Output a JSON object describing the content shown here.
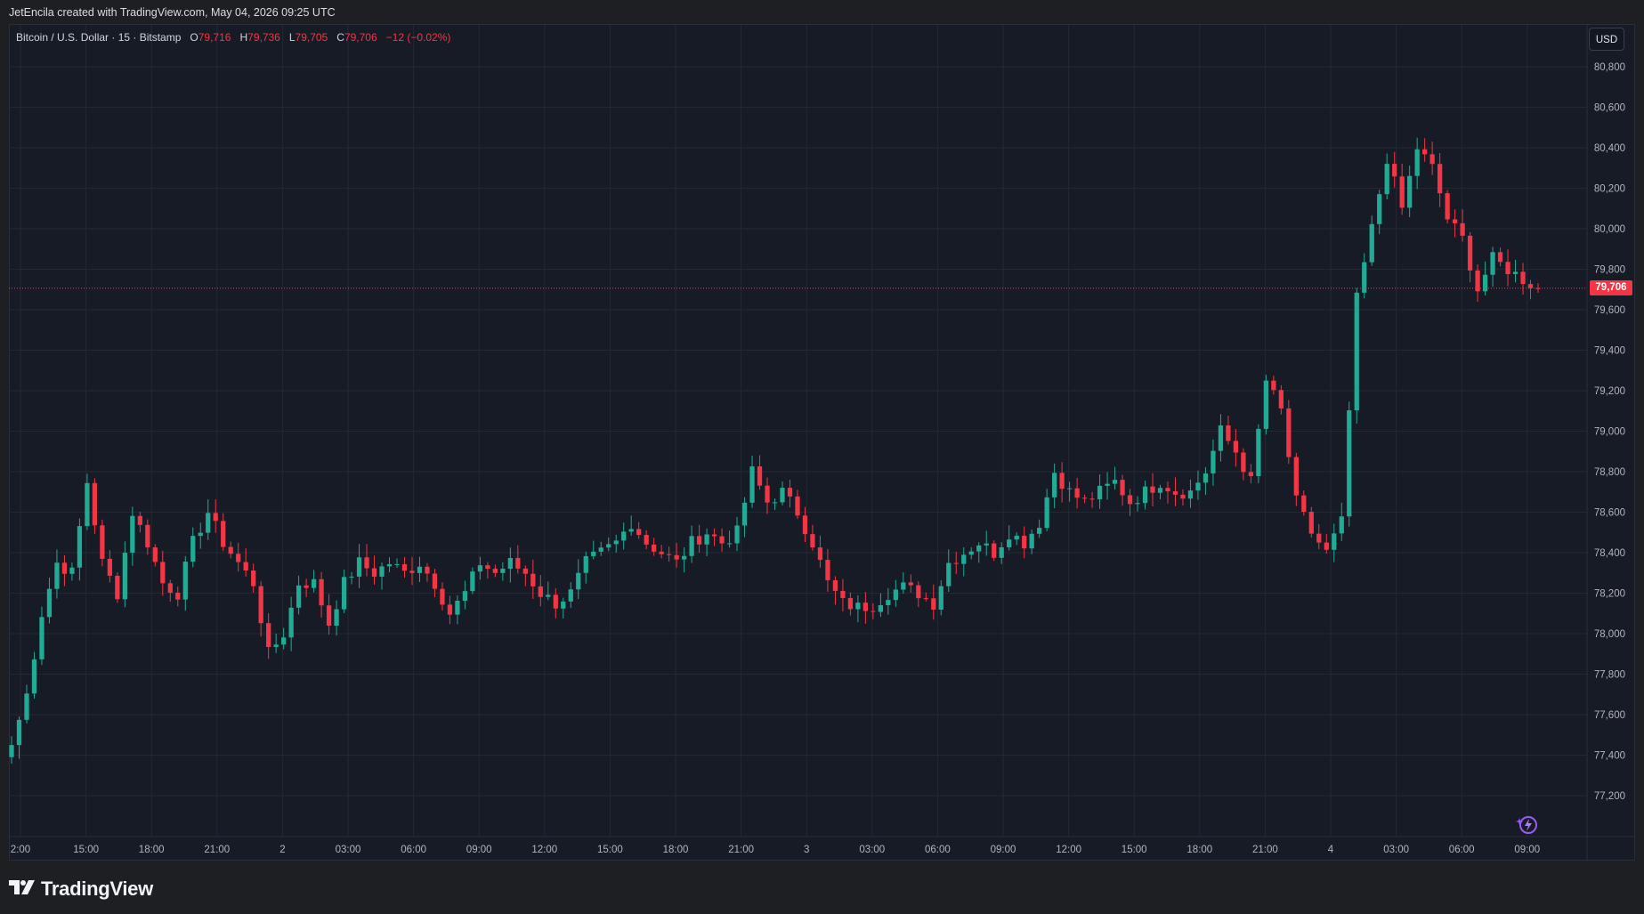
{
  "header": {
    "credit": "JetEncila created with TradingView.com, May 04, 2026 09:25 UTC"
  },
  "legend": {
    "symbol": "Bitcoin / U.S. Dollar · 15 · Bitstamp",
    "o_label": "O",
    "o_value": "79,716",
    "h_label": "H",
    "h_value": "79,736",
    "l_label": "L",
    "l_value": "79,705",
    "c_label": "C",
    "c_value": "79,706",
    "change": "−12 (−0.02%)"
  },
  "currency_button": "USD",
  "last_price_label": "79,706",
  "brand": "TradingView",
  "icons": {
    "logo": "tradingview-logo-icon",
    "assistant": "sparkle-lightning-icon"
  },
  "colors": {
    "up": "#22ab94",
    "down": "#f23645",
    "background": "#171b26",
    "grid": "#242833",
    "last_price": "#f23645"
  },
  "chart_data": {
    "type": "candlestick",
    "symbol": "BTCUSD",
    "interval": "15",
    "exchange": "Bitstamp",
    "grid": true,
    "ylim": [
      77050,
      81000
    ],
    "y_ticks": [
      "77,200",
      "77,400",
      "77,600",
      "77,800",
      "78,000",
      "78,200",
      "78,400",
      "78,600",
      "78,800",
      "79,000",
      "79,200",
      "79,400",
      "79,600",
      "79,800",
      "80,000",
      "80,200",
      "80,400",
      "80,600",
      "80,800"
    ],
    "x_ticks": [
      "2:00",
      "15:00",
      "18:00",
      "21:00",
      "2",
      "03:00",
      "06:00",
      "09:00",
      "12:00",
      "15:00",
      "18:00",
      "21:00",
      "3",
      "03:00",
      "06:00",
      "09:00",
      "12:00",
      "15:00",
      "18:00",
      "21:00",
      "4",
      "03:00",
      "06:00",
      "09:00"
    ],
    "last_price": 79706,
    "close_anchors": [
      [
        0,
        77450
      ],
      [
        2,
        77700
      ],
      [
        4,
        78100
      ],
      [
        6,
        78350
      ],
      [
        8,
        78300
      ],
      [
        10,
        78750
      ],
      [
        12,
        78350
      ],
      [
        14,
        78200
      ],
      [
        16,
        78600
      ],
      [
        18,
        78450
      ],
      [
        20,
        78250
      ],
      [
        22,
        78200
      ],
      [
        24,
        78450
      ],
      [
        26,
        78600
      ],
      [
        28,
        78450
      ],
      [
        30,
        78350
      ],
      [
        32,
        78250
      ],
      [
        34,
        77900
      ],
      [
        36,
        78000
      ],
      [
        38,
        78250
      ],
      [
        40,
        78250
      ],
      [
        42,
        78050
      ],
      [
        44,
        78250
      ],
      [
        46,
        78350
      ],
      [
        48,
        78300
      ],
      [
        50,
        78350
      ],
      [
        52,
        78300
      ],
      [
        54,
        78350
      ],
      [
        56,
        78250
      ],
      [
        58,
        78100
      ],
      [
        60,
        78200
      ],
      [
        62,
        78350
      ],
      [
        64,
        78300
      ],
      [
        66,
        78350
      ],
      [
        68,
        78300
      ],
      [
        70,
        78200
      ],
      [
        72,
        78150
      ],
      [
        74,
        78200
      ],
      [
        76,
        78350
      ],
      [
        78,
        78400
      ],
      [
        80,
        78450
      ],
      [
        82,
        78550
      ],
      [
        84,
        78450
      ],
      [
        86,
        78400
      ],
      [
        88,
        78350
      ],
      [
        90,
        78450
      ],
      [
        92,
        78500
      ],
      [
        94,
        78450
      ],
      [
        96,
        78500
      ],
      [
        98,
        78800
      ],
      [
        100,
        78650
      ],
      [
        102,
        78700
      ],
      [
        104,
        78600
      ],
      [
        106,
        78450
      ],
      [
        108,
        78250
      ],
      [
        110,
        78150
      ],
      [
        112,
        78130
      ],
      [
        114,
        78140
      ],
      [
        116,
        78200
      ],
      [
        118,
        78230
      ],
      [
        120,
        78200
      ],
      [
        122,
        78150
      ],
      [
        124,
        78350
      ],
      [
        126,
        78400
      ],
      [
        128,
        78450
      ],
      [
        130,
        78400
      ],
      [
        132,
        78500
      ],
      [
        134,
        78450
      ],
      [
        136,
        78550
      ],
      [
        138,
        78800
      ],
      [
        140,
        78700
      ],
      [
        142,
        78650
      ],
      [
        144,
        78700
      ],
      [
        146,
        78750
      ],
      [
        148,
        78650
      ],
      [
        150,
        78700
      ],
      [
        152,
        78750
      ],
      [
        154,
        78700
      ],
      [
        156,
        78700
      ],
      [
        158,
        78800
      ],
      [
        160,
        79000
      ],
      [
        162,
        78900
      ],
      [
        164,
        78750
      ],
      [
        166,
        79250
      ],
      [
        168,
        79100
      ],
      [
        170,
        78650
      ],
      [
        172,
        78500
      ],
      [
        174,
        78400
      ],
      [
        176,
        78550
      ],
      [
        178,
        79650
      ],
      [
        180,
        80000
      ],
      [
        182,
        80350
      ],
      [
        184,
        80100
      ],
      [
        186,
        80400
      ],
      [
        188,
        80300
      ],
      [
        190,
        80050
      ],
      [
        192,
        79950
      ],
      [
        194,
        79700
      ],
      [
        196,
        79850
      ],
      [
        198,
        79800
      ],
      [
        200,
        79750
      ],
      [
        202,
        79706
      ]
    ]
  }
}
